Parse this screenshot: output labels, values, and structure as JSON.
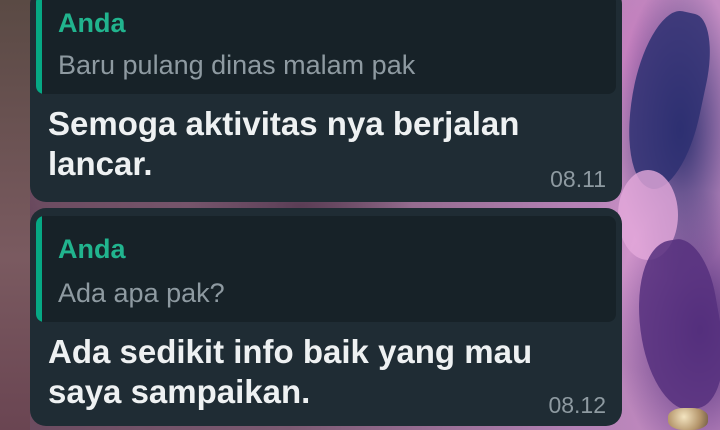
{
  "messages": [
    {
      "quote": {
        "author": "Anda",
        "text": "Baru pulang dinas malam pak"
      },
      "text": "Semoga aktivitas nya berjalan lancar.",
      "time": "08.11"
    },
    {
      "quote": {
        "author": "Anda",
        "text": "Ada apa pak?"
      },
      "text": "Ada sedikit info baik yang mau saya sampaikan.",
      "time": "08.12"
    }
  ],
  "colors": {
    "bubble": "#1f2c34",
    "quote_background": "#172228",
    "quote_bar": "#06a884",
    "quote_author": "#21b48e",
    "secondary_text": "#8e9aa1",
    "message_text": "#eef1f2"
  }
}
